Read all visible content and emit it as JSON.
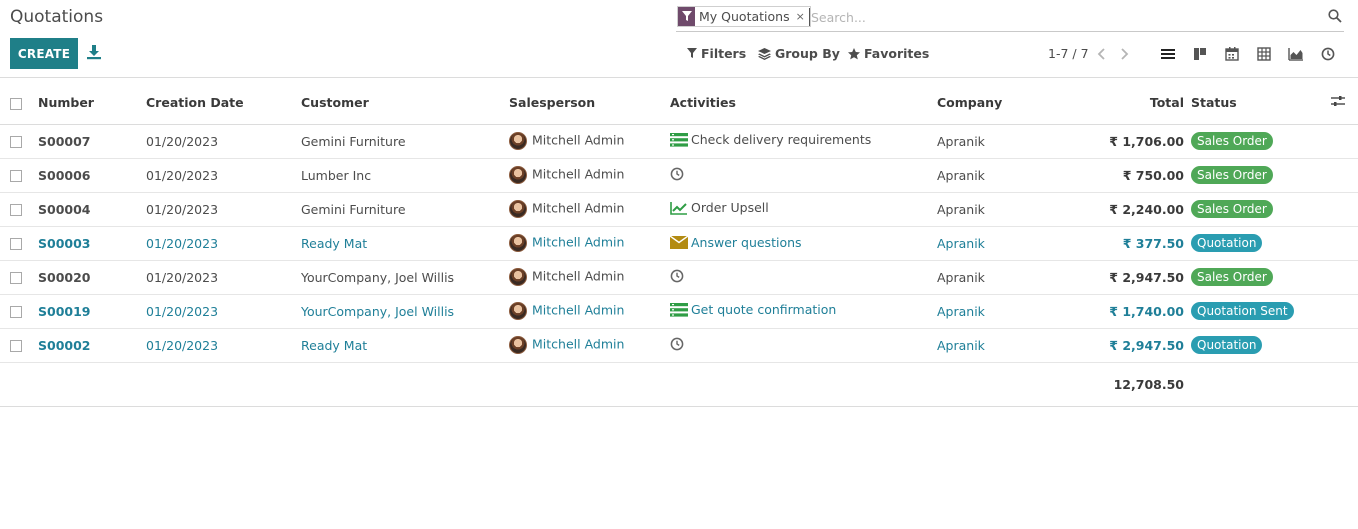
{
  "page": {
    "title": "Quotations"
  },
  "toolbar": {
    "create_label": "CREATE"
  },
  "search": {
    "facet_label": "My Quotations",
    "facet_remove": "×",
    "placeholder": "Search..."
  },
  "search_panel": {
    "filters": "Filters",
    "group_by": "Group By",
    "favorites": "Favorites"
  },
  "pager": {
    "text": "1-7 / 7"
  },
  "colors": {
    "brand": "#1f7f88",
    "link": "#1f7f98",
    "facet": "#6f4a6b",
    "sales_order": "#4fa857",
    "quotation": "#2a9db1",
    "activity_green": "#2f9d45",
    "activity_gold": "#b38b12"
  },
  "columns": {
    "number": "Number",
    "creation_date": "Creation Date",
    "customer": "Customer",
    "salesperson": "Salesperson",
    "activities": "Activities",
    "company": "Company",
    "total": "Total",
    "status": "Status"
  },
  "rows": [
    {
      "number": "S00007",
      "date": "01/20/2023",
      "customer": "Gemini Furniture",
      "salesperson": "Mitchell Admin",
      "activity_icon": "list-icon",
      "activity": "Check delivery requirements",
      "company": "Apranik",
      "total": "₹ 1,706.00",
      "status": "Sales Order",
      "status_color": "#4fa857"
    },
    {
      "number": "S00006",
      "date": "01/20/2023",
      "customer": "Lumber Inc",
      "salesperson": "Mitchell Admin",
      "activity_icon": "clock-icon",
      "activity": "",
      "company": "Apranik",
      "total": "₹ 750.00",
      "status": "Sales Order",
      "status_color": "#4fa857"
    },
    {
      "number": "S00004",
      "date": "01/20/2023",
      "customer": "Gemini Furniture",
      "salesperson": "Mitchell Admin",
      "activity_icon": "chart-icon",
      "activity": "Order Upsell",
      "company": "Apranik",
      "total": "₹ 2,240.00",
      "status": "Sales Order",
      "status_color": "#4fa857"
    },
    {
      "number": "S00003",
      "date": "01/20/2023",
      "customer": "Ready Mat",
      "salesperson": "Mitchell Admin",
      "activity_icon": "envelope-icon",
      "activity": "Answer questions",
      "company": "Apranik",
      "total": "₹ 377.50",
      "status": "Quotation",
      "status_color": "#2a9db1"
    },
    {
      "number": "S00020",
      "date": "01/20/2023",
      "customer": "YourCompany, Joel Willis",
      "salesperson": "Mitchell Admin",
      "activity_icon": "clock-icon",
      "activity": "",
      "company": "Apranik",
      "total": "₹ 2,947.50",
      "status": "Sales Order",
      "status_color": "#4fa857"
    },
    {
      "number": "S00019",
      "date": "01/20/2023",
      "customer": "YourCompany, Joel Willis",
      "salesperson": "Mitchell Admin",
      "activity_icon": "list-icon",
      "activity": "Get quote confirmation",
      "company": "Apranik",
      "total": "₹ 1,740.00",
      "status": "Quotation Sent",
      "status_color": "#2a9db1"
    },
    {
      "number": "S00002",
      "date": "01/20/2023",
      "customer": "Ready Mat",
      "salesperson": "Mitchell Admin",
      "activity_icon": "clock-icon",
      "activity": "",
      "company": "Apranik",
      "total": "₹ 2,947.50",
      "status": "Quotation",
      "status_color": "#2a9db1"
    }
  ],
  "footer": {
    "grand_total": "12,708.50"
  }
}
